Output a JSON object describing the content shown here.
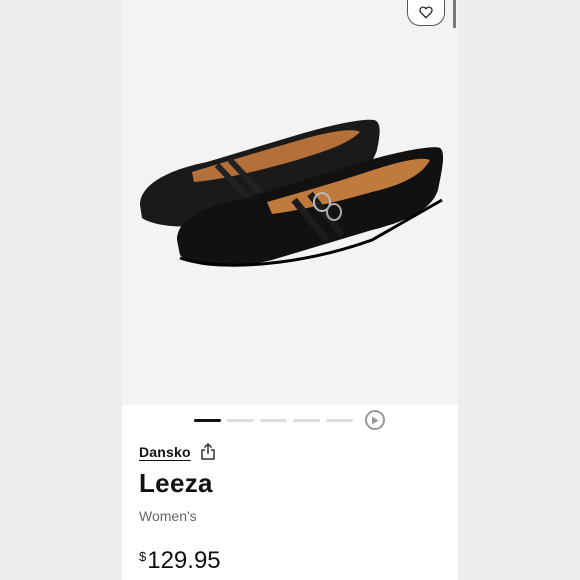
{
  "product": {
    "brand": "Dansko",
    "name": "Leeza",
    "category": "Women's",
    "currency_symbol": "$",
    "price": "129.95"
  },
  "carousel": {
    "total_slides": 5,
    "active_index": 0
  },
  "icons": {
    "favorite": "heart-icon",
    "share": "share-icon",
    "play": "play-icon"
  },
  "colors": {
    "text": "#111111",
    "muted": "#666666",
    "image_bg": "#f3f3f3"
  }
}
